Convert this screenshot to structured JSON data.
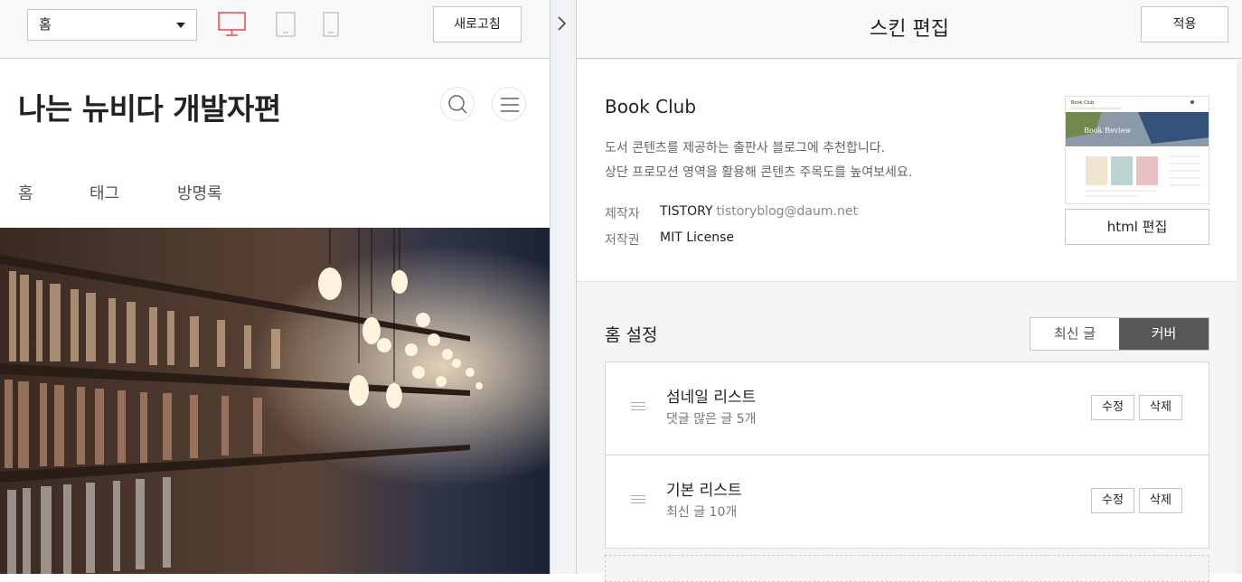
{
  "toolbar": {
    "page_select": "홈",
    "refresh_label": "새로고침"
  },
  "preview": {
    "blog_title": "나는 뉴비다 개발자편",
    "nav": [
      "홈",
      "태그",
      "방명록"
    ]
  },
  "panel": {
    "title": "스킨 편집",
    "apply_label": "적용"
  },
  "skin": {
    "name": "Book Club",
    "description_line1": "도서 콘텐츠를 제공하는 출판사 블로그에 추천합니다.",
    "description_line2": "상단 프로모션 영역을 활용해 콘텐츠 주목도를 높여보세요.",
    "author_label": "제작자",
    "author_name": "TISTORY",
    "author_email": "tistoryblog@daum.net",
    "license_label": "저작권",
    "license": "MIT License",
    "html_edit_label": "html 편집",
    "thumb_title": "Book Club",
    "thumb_banner_text": "Book Review"
  },
  "home_settings": {
    "title": "홈 설정",
    "modes": [
      "최신 글",
      "커버"
    ],
    "selected_mode": "커버",
    "items": [
      {
        "title": "섬네일 리스트",
        "subtitle": "댓글 많은 글 5개",
        "edit_label": "수정",
        "delete_label": "삭제"
      },
      {
        "title": "기본 리스트",
        "subtitle": "최신 글 10개",
        "edit_label": "수정",
        "delete_label": "삭제"
      }
    ]
  },
  "colors": {
    "accent_desktop": "#e8474b",
    "segment_active": "#575757",
    "toolbar_bg": "#f7f8fa"
  }
}
